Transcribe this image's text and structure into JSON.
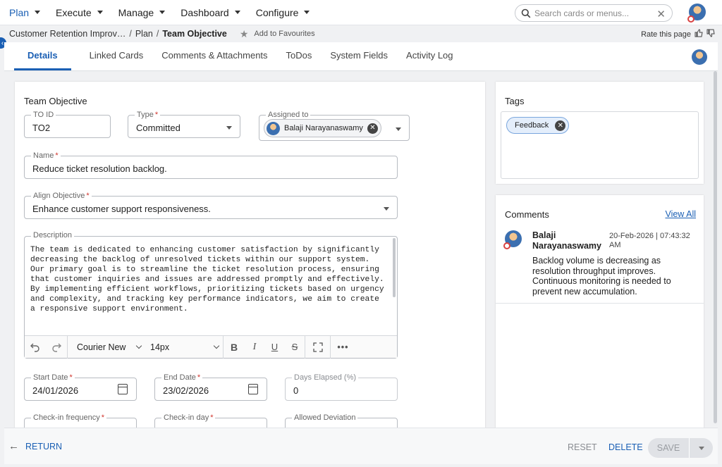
{
  "topnav": {
    "items": [
      {
        "label": "Plan"
      },
      {
        "label": "Execute"
      },
      {
        "label": "Manage"
      },
      {
        "label": "Dashboard"
      },
      {
        "label": "Configure"
      }
    ],
    "search_placeholder": "Search cards or menus...",
    "active_color": "#1a5fb4"
  },
  "breadcrumb": {
    "items": [
      "Customer Retention Improv…",
      "Plan"
    ],
    "current": "Team Objective",
    "favourite_label": "Add to Favourites",
    "rate_label": "Rate this page"
  },
  "tabs": [
    {
      "label": "Details",
      "active": true
    },
    {
      "label": "Linked Cards"
    },
    {
      "label": "Comments & Attachments"
    },
    {
      "label": "ToDos"
    },
    {
      "label": "System Fields"
    },
    {
      "label": "Activity Log"
    }
  ],
  "form": {
    "section_title": "Team Objective",
    "to_id": {
      "label": "TO ID",
      "value": "TO2"
    },
    "type": {
      "label": "Type",
      "value": "Committed"
    },
    "assigned_to": {
      "label": "Assigned to",
      "value": "Balaji Narayanaswamy"
    },
    "name": {
      "label": "Name",
      "value": "Reduce ticket resolution backlog."
    },
    "align_objective": {
      "label": "Align Objective",
      "value": "Enhance customer support responsiveness."
    },
    "description": {
      "label": "Description",
      "text": "The team is dedicated to enhancing customer satisfaction by significantly decreasing the backlog of unresolved tickets within our support system. Our primary goal is to streamline the ticket resolution process, ensuring that customer inquiries and issues are addressed promptly and effectively. By implementing efficient workflows, prioritizing tickets based on urgency and complexity, and tracking key performance indicators, we aim to create a responsive support environment.",
      "font_family": "Courier New",
      "font_size": "14px"
    },
    "start_date": {
      "label": "Start Date",
      "value": "24/01/2026"
    },
    "end_date": {
      "label": "End Date",
      "value": "23/02/2026"
    },
    "days_elapsed": {
      "label": "Days Elapsed (%)",
      "value": "0"
    },
    "checkin_frequency": {
      "label": "Check-in frequency"
    },
    "checkin_day": {
      "label": "Check-in day"
    },
    "allowed_deviation": {
      "label": "Allowed Deviation"
    },
    "required_color": "#d0342c"
  },
  "tags": {
    "title": "Tags",
    "items": [
      "Feedback"
    ]
  },
  "comments": {
    "title": "Comments",
    "view_all": "View All",
    "items": [
      {
        "author": "Balaji Narayanaswamy",
        "date": "20-Feb-2026 | 07:43:32 AM",
        "body": "Backlog volume is decreasing as resolution throughput improves. Continuous monitoring is needed to prevent new accumulation."
      }
    ]
  },
  "footer": {
    "return_label": "RETURN",
    "reset_label": "RESET",
    "delete_label": "DELETE",
    "save_label": "SAVE"
  },
  "icons": {
    "search": "search-icon",
    "clear": "close-icon",
    "star": "star-icon",
    "thumbs_up": "thumbs-up-icon",
    "thumbs_down": "thumbs-down-icon",
    "undo": "undo-icon",
    "redo": "redo-icon",
    "bold": "bold-icon",
    "italic": "italic-icon",
    "underline": "underline-icon",
    "strike": "strikethrough-icon",
    "fullscreen": "fullscreen-icon",
    "more": "more-icon",
    "calendar": "calendar-icon",
    "return_arrow": "arrow-left-icon"
  }
}
